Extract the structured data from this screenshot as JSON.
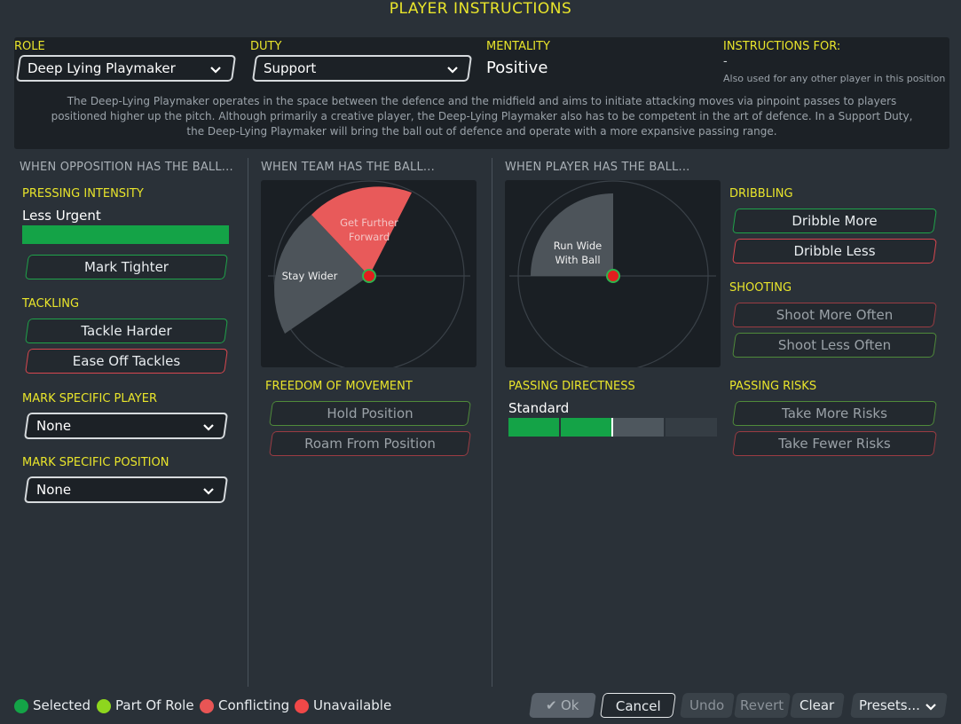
{
  "title": "PLAYER INSTRUCTIONS",
  "header": {
    "role_label": "ROLE",
    "role_value": "Deep Lying Playmaker",
    "duty_label": "DUTY",
    "duty_value": "Support",
    "mentality_label": "MENTALITY",
    "mentality_value": "Positive",
    "instructions_for_label": "INSTRUCTIONS FOR:",
    "instructions_for_value": "-",
    "instructions_for_note": "Also used for any other player in this position",
    "description_lines": [
      "The Deep-Lying Playmaker operates in the space between the defence and the midfield and aims to initiate attacking moves via pinpoint passes to players",
      "positioned higher up the pitch. Although primarily a creative player, the Deep-Lying Playmaker also has to be competent in the art of defence. In a Support Duty,",
      "the Deep-Lying Playmaker will bring the ball out of defence and operate with a more expansive passing range."
    ]
  },
  "opposition": {
    "heading": "WHEN OPPOSITION HAS THE BALL...",
    "pressing_label": "PRESSING INTENSITY",
    "pressing_value": "Less Urgent",
    "pressing_level": 1.0,
    "mark_tighter": "Mark Tighter",
    "tackling_label": "TACKLING",
    "tackle_harder": "Tackle Harder",
    "ease_off": "Ease Off Tackles",
    "mark_player_label": "MARK SPECIFIC PLAYER",
    "mark_player_value": "None",
    "mark_position_label": "MARK SPECIFIC POSITION",
    "mark_position_value": "None"
  },
  "team": {
    "heading": "WHEN TEAM HAS THE BALL...",
    "zone_forward_line1": "Get Further",
    "zone_forward_line2": "Forward",
    "zone_wider": "Stay Wider",
    "freedom_label": "FREEDOM OF MOVEMENT",
    "hold_position": "Hold Position",
    "roam": "Roam From Position"
  },
  "player": {
    "heading": "WHEN PLAYER HAS THE BALL...",
    "zone_run_line1": "Run Wide",
    "zone_run_line2": "With Ball",
    "dribbling_label": "DRIBBLING",
    "dribble_more": "Dribble More",
    "dribble_less": "Dribble Less",
    "shooting_label": "SHOOTING",
    "shoot_more": "Shoot More Often",
    "shoot_less": "Shoot Less Often",
    "passing_directness_label": "PASSING DIRECTNESS",
    "passing_directness_value": "Standard",
    "passing_directness_level": 0.5,
    "passing_risks_label": "PASSING RISKS",
    "more_risks": "Take More Risks",
    "fewer_risks": "Take Fewer Risks"
  },
  "legend": {
    "selected": "Selected",
    "part_of_role": "Part Of Role",
    "conflicting": "Conflicting",
    "unavailable": "Unavailable"
  },
  "footer": {
    "ok": "Ok",
    "cancel": "Cancel",
    "undo": "Undo",
    "revert": "Revert",
    "clear": "Clear",
    "presets": "Presets..."
  },
  "colors": {
    "accent_yellow": "#e9e52b",
    "selected_green": "#14a347",
    "part_of_role": "#8ed61e",
    "conflicting": "#e85555",
    "unavailable": "#f04848"
  }
}
